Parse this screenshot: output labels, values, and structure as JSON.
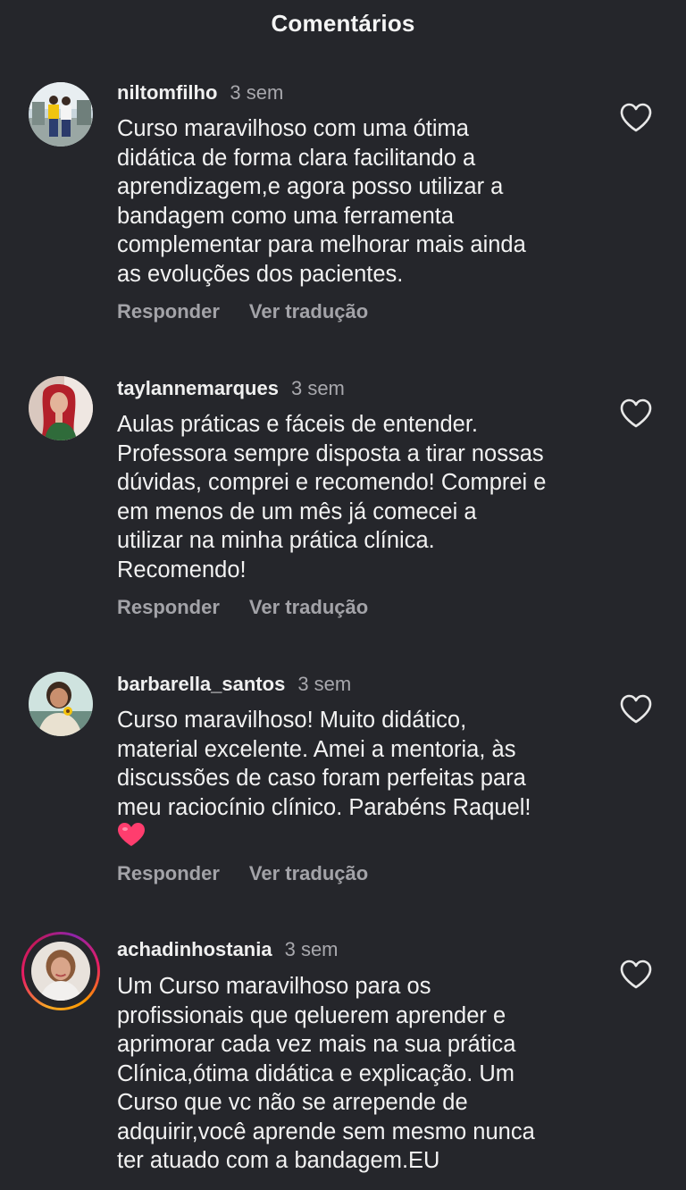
{
  "header": {
    "title": "Comentários"
  },
  "icons": {
    "like": "heart-outline-icon",
    "emoji": "heart-emoji-icon"
  },
  "colors": {
    "background": "#25262b",
    "text": "#f2f2f2",
    "secondary": "#a8a8ad",
    "emoji_heart": "#ff3d6e"
  },
  "comments": [
    {
      "username": "niltomfilho",
      "time": "3 sem",
      "text": "Curso maravilhoso com uma ótima\ndidática de forma clara facilitando a\naprendizagem,e agora posso utilizar a\nbandagem como uma ferramenta\ncomplementar para melhorar mais ainda\nas evoluções dos pacientes.",
      "reply_label": "Responder",
      "translate_label": "Ver tradução"
    },
    {
      "username": "taylannemarques",
      "time": "3 sem",
      "text": "Aulas práticas e fáceis de entender.\nProfessora sempre disposta a tirar nossas\ndúvidas, comprei e recomendo! Comprei e\nem menos de um mês já comecei a\nutilizar na minha prática clínica.\nRecomendo!",
      "reply_label": "Responder",
      "translate_label": "Ver tradução"
    },
    {
      "username": "barbarella_santos",
      "time": "3 sem",
      "text": "Curso maravilhoso! Muito didático,\nmaterial excelente. Amei a mentoria,  às\ndiscussões de caso foram perfeitas para\nmeu raciocínio clínico. Parabéns Raquel!",
      "reply_label": "Responder",
      "translate_label": "Ver tradução"
    },
    {
      "username": "achadinhostania",
      "time": "3 sem",
      "text": "Um Curso maravilhoso para os\nprofissionais que qeluerem aprender e\naprimorar cada vez mais na sua prática\nClínica,ótima didática e explicação. Um\nCurso que vc não se arrepende de\nadquirir,você aprende sem mesmo nunca\nter atuado com a bandagem.EU"
    }
  ]
}
